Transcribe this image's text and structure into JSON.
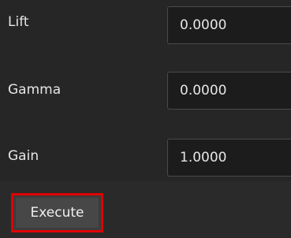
{
  "params": [
    {
      "label": "Lift",
      "value": "0.0000"
    },
    {
      "label": "Gamma",
      "value": "0.0000"
    },
    {
      "label": "Gain",
      "value": "1.0000"
    }
  ],
  "actions": {
    "execute_label": "Execute"
  },
  "colors": {
    "background": "#262626",
    "field_background": "#1c1c1c",
    "highlight_border": "#e00000"
  }
}
